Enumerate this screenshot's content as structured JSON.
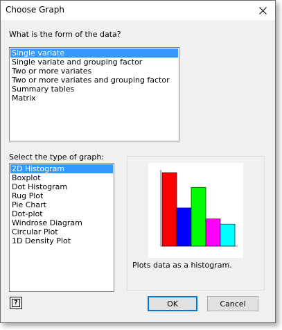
{
  "window": {
    "title": "Choose Graph"
  },
  "data_form": {
    "prompt": "What is the form of the data?",
    "items": [
      "Single variate",
      "Single variate and grouping factor",
      "Two or more variates",
      "Two or more variates and grouping factor",
      "Summary tables",
      "Matrix"
    ],
    "selected_index": 0
  },
  "graph_type": {
    "prompt": "Select the type of graph:",
    "items": [
      "2D Histogram",
      "Boxplot",
      "Dot Histogram",
      "Rug Plot",
      "Pie Chart",
      "Dot-plot",
      "Windrose Diagram",
      "Circular Plot",
      "1D Density Plot"
    ],
    "selected_index": 0
  },
  "preview": {
    "description": "Plots data as a histogram.",
    "bar_colors": [
      "#ff0000",
      "#0000ff",
      "#00ff00",
      "#ff00ff",
      "#00ffff"
    ],
    "bar_heights_relative": [
      1.0,
      0.52,
      0.8,
      0.37,
      0.3
    ]
  },
  "buttons": {
    "ok": "OK",
    "cancel": "Cancel",
    "help_icon": "help-icon"
  }
}
